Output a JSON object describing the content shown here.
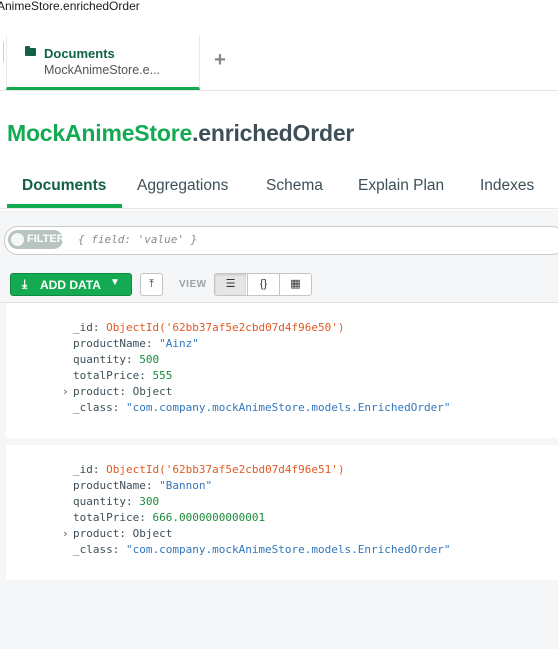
{
  "window": {
    "title": "AnimeStore.enrichedOrder"
  },
  "tabs": {
    "active": {
      "title": "Documents",
      "subtitle": "MockAnimeStore.e..."
    },
    "add_symbol": "+"
  },
  "namespace": {
    "database": "MockAnimeStore",
    "collection": ".enrichedOrder"
  },
  "subtabs": [
    "Documents",
    "Aggregations",
    "Schema",
    "Explain Plan",
    "Indexes"
  ],
  "filter": {
    "pill_label": "FILTER",
    "placeholder": "{ field: 'value' }"
  },
  "toolbar": {
    "add_data_label": "ADD DATA",
    "view_label": "VIEW",
    "view_modes": [
      "list-view-icon",
      "json-view-icon",
      "table-view-icon"
    ]
  },
  "documents": [
    {
      "_id": "ObjectId('62bb37af5e2cbd07d4f96e50')",
      "productName": "\"Ainz\"",
      "quantity": "500",
      "totalPrice": "555",
      "product": "Object",
      "_class": "\"com.company.mockAnimeStore.models.EnrichedOrder\""
    },
    {
      "_id": "ObjectId('62bb37af5e2cbd07d4f96e51')",
      "productName": "\"Bannon\"",
      "quantity": "300",
      "totalPrice": "666.0000000000001",
      "product": "Object",
      "_class": "\"com.company.mockAnimeStore.models.EnrichedOrder\""
    }
  ],
  "field_keys": {
    "id": "_id:",
    "productName": "productName:",
    "quantity": "quantity:",
    "totalPrice": "totalPrice:",
    "product": "product:",
    "class": "_class:"
  },
  "colors": {
    "accent": "#13aa52",
    "dark_green": "#116149",
    "oid": "#e25a24",
    "string": "#3176bd",
    "number": "#1a8a3a"
  }
}
